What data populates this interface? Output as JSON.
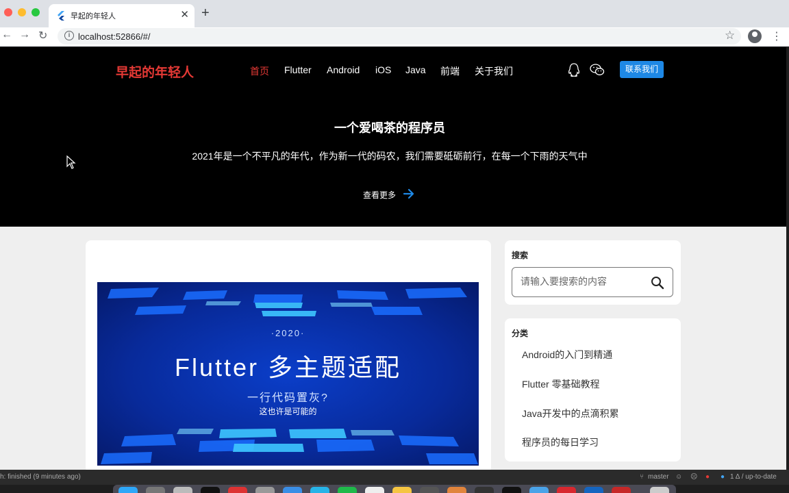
{
  "browser": {
    "tab_title": "早起的年轻人",
    "tab_close": "✕",
    "new_tab": "+",
    "url": "localhost:52866/#/",
    "back": "←",
    "forward": "→",
    "reload": "↻",
    "star": "☆",
    "menu": "⋮"
  },
  "site": {
    "logo": "早起的年轻人",
    "nav": [
      "首页",
      "Flutter",
      "Android",
      "iOS",
      "Java",
      "前端",
      "关于我们"
    ],
    "contact_button": "联系我们",
    "icons": [
      "qq-icon",
      "wechat-icon"
    ]
  },
  "hero": {
    "title": "一个爱喝茶的程序员",
    "subtitle": "2021年是一个不平凡的年代，作为新一代的码农，我们需要砥砺前行，在每一个下雨的天气中",
    "more": "查看更多"
  },
  "banner": {
    "year": "·2020·",
    "title": "Flutter 多主题适配",
    "line1": "一行代码置灰?",
    "line2": "这也许是可能的"
  },
  "sidebar": {
    "search_title": "搜索",
    "search_placeholder": "请输入要搜索的内容",
    "category_title": "分类",
    "categories": [
      "Android的入门到精通",
      "Flutter 零基础教程",
      "Java开发中的点滴积累",
      "程序员的每日学习"
    ]
  },
  "statusbar": {
    "left": "h: finished (9 minutes ago)",
    "branch": "master",
    "sync": "1 Δ / up-to-date"
  },
  "colors": {
    "accent_red": "#e53935",
    "accent_blue": "#1e88e5",
    "hero_bg": "#000000",
    "page_bg": "#efefef"
  }
}
